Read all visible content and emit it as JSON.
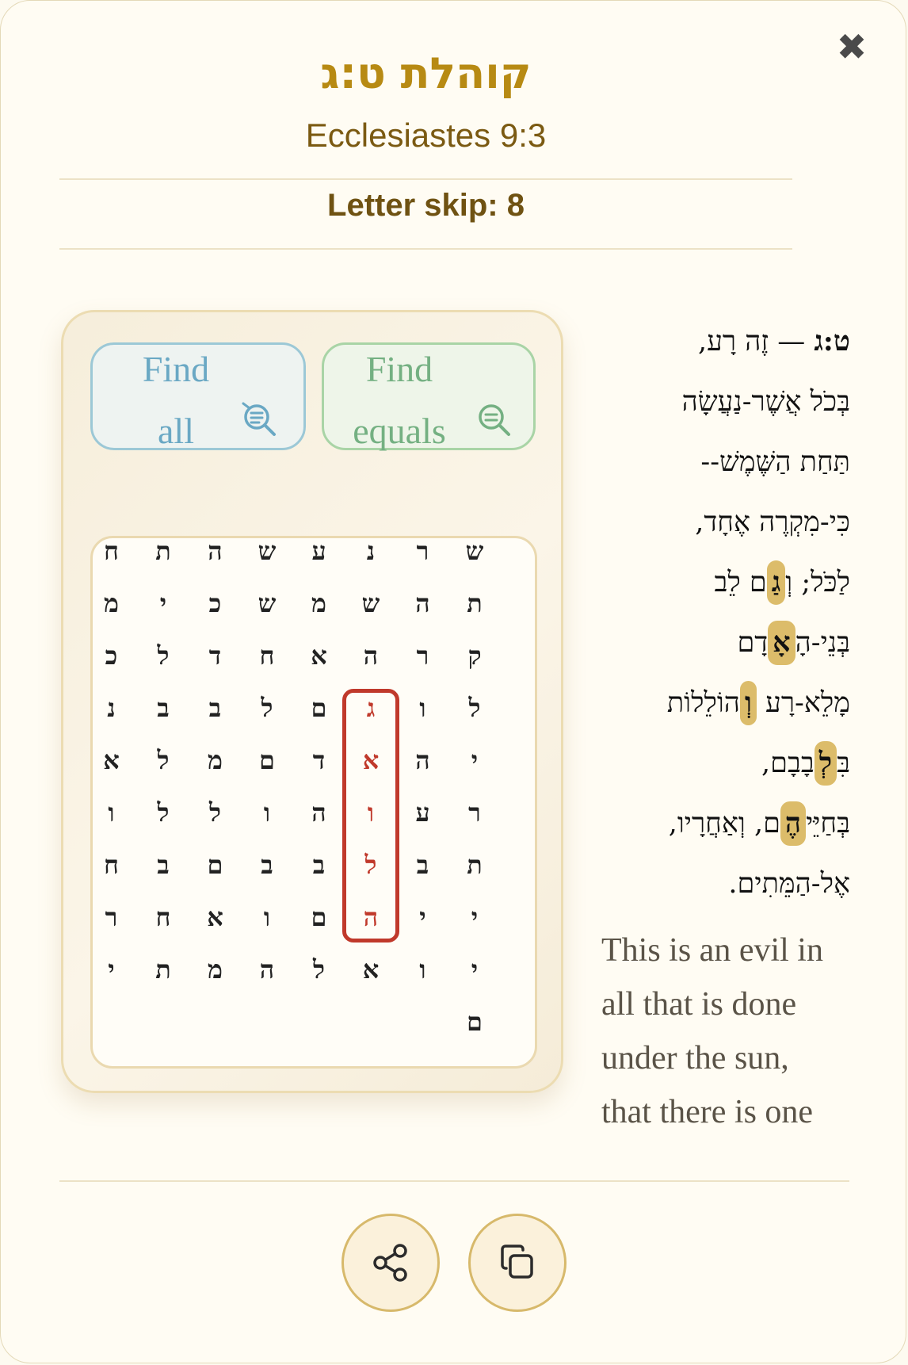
{
  "header": {
    "close_glyph": "✖",
    "title_he": "קוהלת ט:ג",
    "title_en": "Ecclesiastes 9:3",
    "letter_skip": "Letter skip: 8"
  },
  "buttons": {
    "find_all": [
      "Find",
      "all"
    ],
    "find_equals": [
      "Find",
      "equals"
    ]
  },
  "grid": {
    "rows": [
      [
        "ח",
        "ת",
        "ה",
        "ש",
        "ע",
        "נ",
        "ר",
        "ש"
      ],
      [
        "מ",
        "י",
        "כ",
        "ש",
        "מ",
        "ש",
        "ה",
        "ת"
      ],
      [
        "כ",
        "ל",
        "ד",
        "ח",
        "א",
        "ה",
        "ר",
        "ק"
      ],
      [
        "נ",
        "ב",
        "ב",
        "ל",
        "ם",
        "ג",
        "ו",
        "ל"
      ],
      [
        "א",
        "ל",
        "מ",
        "ם",
        "ד",
        "א",
        "ה",
        "י"
      ],
      [
        "ו",
        "ל",
        "ל",
        "ו",
        "ה",
        "ו",
        "ע",
        "ר"
      ],
      [
        "ח",
        "ב",
        "ם",
        "ב",
        "ב",
        "ל",
        "ב",
        "ת"
      ],
      [
        "ר",
        "ח",
        "א",
        "ו",
        "ם",
        "ה",
        "י",
        "י"
      ],
      [
        "י",
        "ת",
        "מ",
        "ה",
        "ל",
        "א",
        "ו",
        "י"
      ],
      [
        "",
        "",
        "",
        "",
        "",
        "",
        "",
        "ם"
      ]
    ],
    "highlight": {
      "column": 5,
      "row_start": 3,
      "row_end": 7,
      "color": "#c0392b"
    }
  },
  "verse": {
    "lines": [
      {
        "ref": "ט:ג",
        "text": " — זֶה רָע,"
      },
      {
        "pre": "בְּכֹל אֲשֶׁר-נַעֲשָׂה"
      },
      {
        "pre": "תַּחַת הַשֶּׁמֶשׁ--"
      },
      {
        "pre": "כִּי-מִקְרֶה אֶחָד,"
      },
      {
        "pre": "לַכֹּל; וְ",
        "mark": "גַ",
        "post": "ם לֵב"
      },
      {
        "pre": "בְּנֵי-הָ",
        "mark": "אָ",
        "post": "דָם"
      },
      {
        "pre": "מָלֵא-רָע ",
        "mark": "וְ",
        "post": "הוֹלֵלוֹת"
      },
      {
        "pre": "בִּ",
        "mark": "לְ",
        "post": "בָבָם,"
      },
      {
        "pre": "בְּחַיֵּי",
        "mark": "הֶ",
        "post": "ם, וְאַחֲרָיו,"
      },
      {
        "pre": "אֶל-הַמֵּתִים."
      }
    ],
    "mark_color": "#dcbc6a"
  },
  "translation": {
    "lines": [
      "This is an evil in",
      "all that is done",
      "under the sun,",
      "that there is one"
    ]
  },
  "actions": {
    "share_icon": "share-icon",
    "copy_icon": "copy-icon"
  },
  "colors": {
    "accent_gold": "#b78a13",
    "highlight_red": "#c0392b",
    "find_all_blue": "#6aa8c4",
    "find_equals_green": "#74b082"
  }
}
